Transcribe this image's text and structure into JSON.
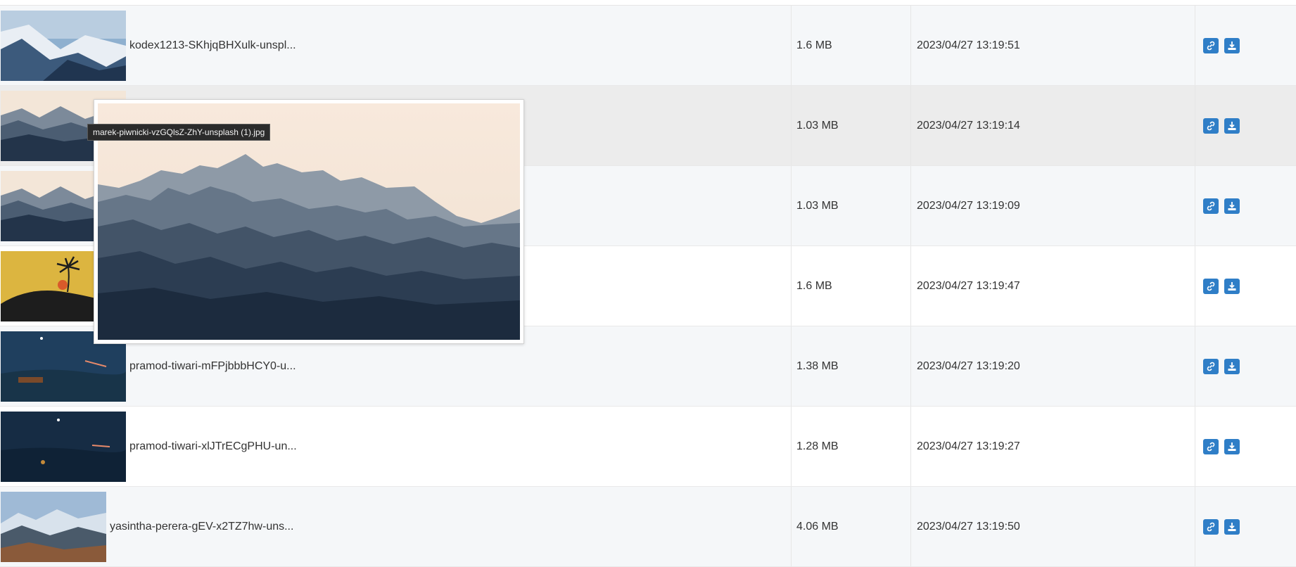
{
  "files": [
    {
      "name": "kodex1213-SKhjqBHXulk-unspl...",
      "size": "1.6 MB",
      "date": "2023/04/27 13:19:51"
    },
    {
      "name": "",
      "size": "1.03 MB",
      "date": "2023/04/27 13:19:14"
    },
    {
      "name": "",
      "size": "1.03 MB",
      "date": "2023/04/27 13:19:09"
    },
    {
      "name": "",
      "size": "1.6 MB",
      "date": "2023/04/27 13:19:47"
    },
    {
      "name": "pramod-tiwari-mFPjbbbHCY0-u...",
      "size": "1.38 MB",
      "date": "2023/04/27 13:19:20"
    },
    {
      "name": "pramod-tiwari-xlJTrECgPHU-un...",
      "size": "1.28 MB",
      "date": "2023/04/27 13:19:27"
    },
    {
      "name": "yasintha-perera-gEV-x2TZ7hw-uns...",
      "size": "4.06 MB",
      "date": "2023/04/27 13:19:50"
    }
  ],
  "preview": {
    "tooltip": "marek-piwnicki-vzGQlsZ-ZhY-unsplash (1).jpg"
  },
  "icons": {
    "link": "link-icon",
    "download": "download-icon"
  },
  "colors": {
    "accent": "#2f7ec7",
    "row_alt": "#f5f7f9",
    "row_hover": "#ececec",
    "tooltip_bg": "#2b2b2b"
  }
}
